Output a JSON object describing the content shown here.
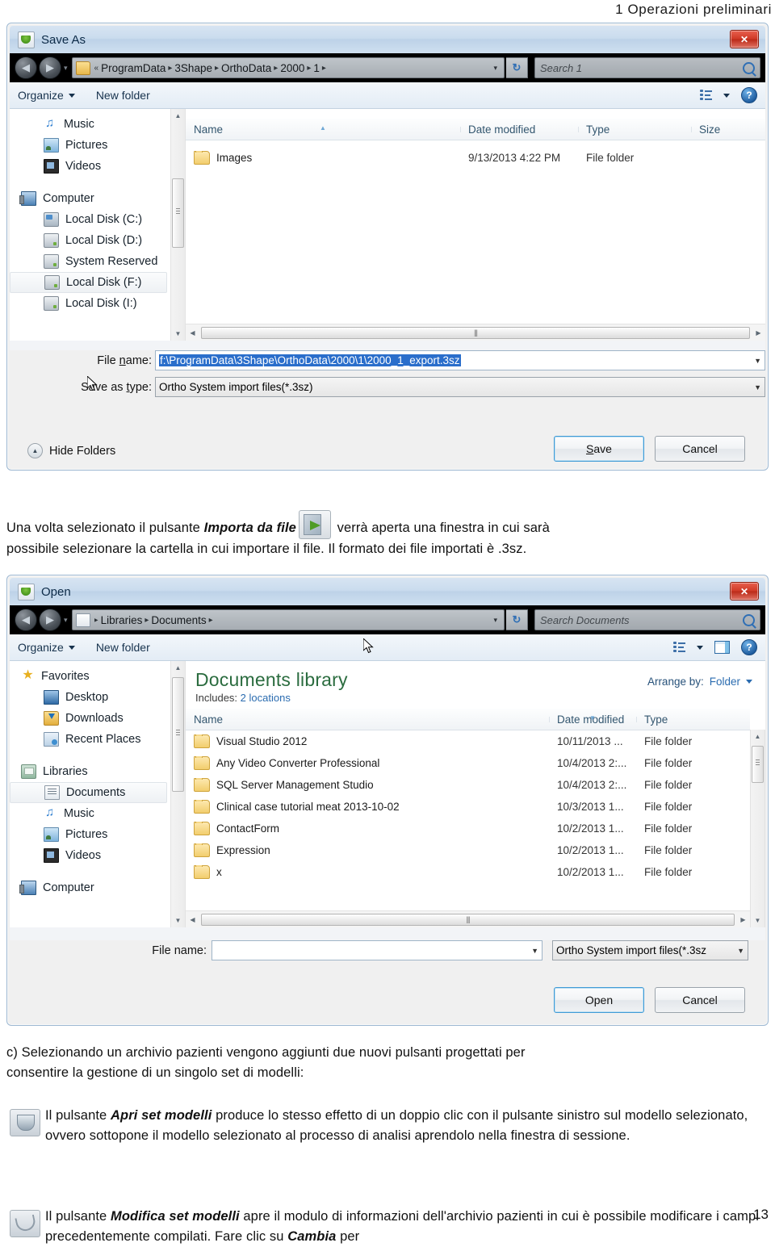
{
  "header": {
    "running_title": "1 Operazioni preliminari"
  },
  "save_dialog": {
    "title": "Save As",
    "close_label": "✕",
    "address": {
      "back_icon": "◀",
      "forward_icon": "▶",
      "dropdown_caret": "▾",
      "prefix": "«",
      "crumbs": [
        "ProgramData",
        "3Shape",
        "OrthoData",
        "2000",
        "1"
      ],
      "separator": "▸",
      "refresh_icon": "↻",
      "search_placeholder": "Search 1"
    },
    "commandbar": {
      "organize": "Organize",
      "new_folder": "New folder",
      "view_caret": "▾",
      "help_label": "?"
    },
    "nav_items": [
      {
        "label": "Music",
        "icon": "music-icon",
        "indent": "indent",
        "selected": false
      },
      {
        "label": "Pictures",
        "icon": "picture-icon",
        "indent": "indent",
        "selected": false
      },
      {
        "label": "Videos",
        "icon": "video-icon",
        "indent": "indent",
        "selected": false
      },
      {
        "label": "Computer",
        "icon": "computer-icon",
        "indent": "root",
        "selected": false
      },
      {
        "label": "Local Disk (C:)",
        "icon": "disk-system-icon",
        "indent": "indent",
        "selected": false
      },
      {
        "label": "Local Disk (D:)",
        "icon": "disk-icon",
        "indent": "indent",
        "selected": false
      },
      {
        "label": "System Reserved",
        "icon": "disk-icon",
        "indent": "indent",
        "selected": false
      },
      {
        "label": "Local Disk (F:)",
        "icon": "disk-icon",
        "indent": "indent",
        "selected": true
      },
      {
        "label": "Local Disk (I:)",
        "icon": "disk-icon",
        "indent": "indent",
        "selected": false
      }
    ],
    "columns": [
      "Name",
      "Date modified",
      "Type",
      "Size"
    ],
    "rows": [
      {
        "name": "Images",
        "date": "9/13/2013 4:22 PM",
        "type": "File folder",
        "size": ""
      }
    ],
    "form": {
      "filename_label": "File name:",
      "filename_value": "f:\\ProgramData\\3Shape\\OrthoData\\2000\\1\\2000_1_export.3sz",
      "savetype_label": "Save as type:",
      "savetype_value": "Ortho System import files(*.3sz)",
      "hide_folders": "Hide Folders",
      "save_button": "Save",
      "cancel_button": "Cancel"
    }
  },
  "paragraph_mid": {
    "line1_a": "Una volta selezionato il pulsante ",
    "line1_b": "Importa da file",
    "line1_c": " verrà aperta una finestra in cui sarà",
    "line2": "possibile selezionare la cartella in cui importare il file. Il formato dei file importati è .3sz."
  },
  "open_dialog": {
    "title": "Open",
    "close_label": "✕",
    "address": {
      "back_icon": "◀",
      "forward_icon": "▶",
      "dropdown_caret": "▾",
      "crumbs": [
        "Libraries",
        "Documents"
      ],
      "separator": "▸",
      "refresh_icon": "↻",
      "search_placeholder": "Search Documents"
    },
    "commandbar": {
      "organize": "Organize",
      "new_folder": "New folder",
      "view_caret": "▾",
      "help_label": "?"
    },
    "nav_items": [
      {
        "label": "Favorites",
        "icon": "star-icon",
        "indent": "root",
        "selected": false
      },
      {
        "label": "Desktop",
        "icon": "desktop-icon",
        "indent": "indent",
        "selected": false
      },
      {
        "label": "Downloads",
        "icon": "downloads-icon",
        "indent": "indent",
        "selected": false
      },
      {
        "label": "Recent Places",
        "icon": "recent-places-icon",
        "indent": "indent",
        "selected": false
      },
      {
        "label": "Libraries",
        "icon": "libraries-icon",
        "indent": "root",
        "selected": false
      },
      {
        "label": "Documents",
        "icon": "document-icon",
        "indent": "indent",
        "selected": true
      },
      {
        "label": "Music",
        "icon": "music-icon",
        "indent": "indent",
        "selected": false
      },
      {
        "label": "Pictures",
        "icon": "picture-icon",
        "indent": "indent",
        "selected": false
      },
      {
        "label": "Videos",
        "icon": "video-icon",
        "indent": "indent",
        "selected": false
      },
      {
        "label": "Computer",
        "icon": "computer-icon",
        "indent": "root",
        "selected": false
      }
    ],
    "library": {
      "title": "Documents library",
      "includes_label": "Includes:",
      "includes_value": "2 locations",
      "arrange_label": "Arrange by:",
      "arrange_value": "Folder",
      "arrange_caret": "▾"
    },
    "columns": [
      "Name",
      "Date modified",
      "Type"
    ],
    "rows": [
      {
        "name": "Visual Studio 2012",
        "date": "10/11/2013 ...",
        "type": "File folder"
      },
      {
        "name": "Any Video Converter Professional",
        "date": "10/4/2013 2:...",
        "type": "File folder"
      },
      {
        "name": "SQL Server Management Studio",
        "date": "10/4/2013 2:...",
        "type": "File folder"
      },
      {
        "name": "Clinical case tutorial meat 2013-10-02",
        "date": "10/3/2013 1...",
        "type": "File folder"
      },
      {
        "name": "ContactForm",
        "date": "10/2/2013 1...",
        "type": "File folder"
      },
      {
        "name": "Expression",
        "date": "10/2/2013 1...",
        "type": "File folder"
      },
      {
        "name": "x",
        "date": "10/2/2013 1...",
        "type": "File folder"
      }
    ],
    "form": {
      "filename_label": "File name:",
      "filename_value": "",
      "filetype_value": "Ortho System import files(*.3sz",
      "open_button": "Open",
      "cancel_button": "Cancel"
    }
  },
  "paragraph_c": {
    "line1": "c) Selezionando un archivio pazienti vengono aggiunti due nuovi pulsanti progettati per",
    "line2": "consentire la gestione di un singolo set di modelli:"
  },
  "bullets": [
    {
      "a": "Il pulsante ",
      "b": "Apri set modelli",
      "c": " produce lo stesso effetto di un doppio clic con il pulsante sinistro sul modello selezionato, ovvero sottopone il modello selezionato al processo di analisi aprendolo nella finestra di sessione."
    },
    {
      "a": "Il pulsante ",
      "b": "Modifica set modelli",
      "c": " apre il modulo di informazioni dell'archivio pazienti in cui è possibile modificare i campi precedentemente compilati. Fare clic su ",
      "d": "Cambia",
      "e": " per"
    }
  ],
  "footer": {
    "page_number": "13"
  }
}
